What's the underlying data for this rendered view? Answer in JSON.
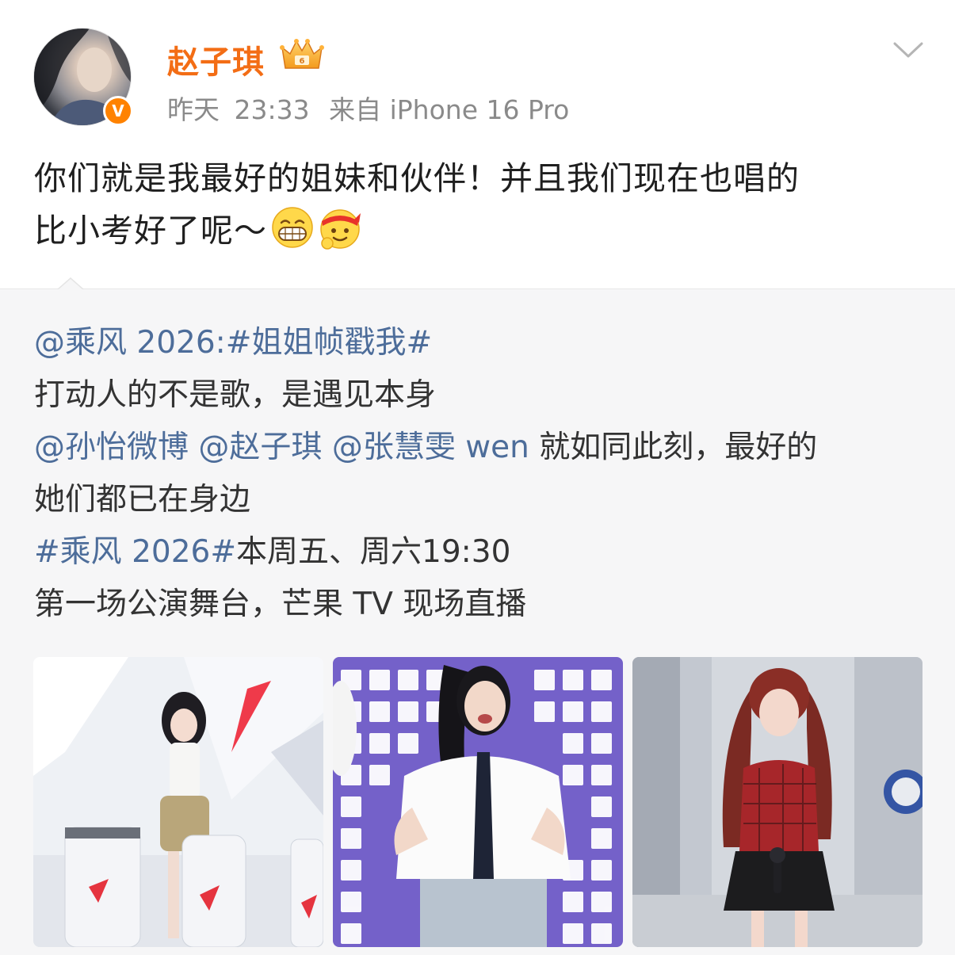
{
  "post": {
    "username": "赵子琪",
    "time_day": "昨天",
    "time_clock": "23:33",
    "source": "来自 iPhone 16 Pro",
    "verified_mark": "V",
    "text_line1": "你们就是我最好的姐妹和伙伴！并且我们现在也唱的",
    "text_line2": "比小考好了呢～"
  },
  "repost": {
    "author_mention": "@乘风 2026",
    "colon": ":",
    "hashtag1": "#姐姐帧戳我#",
    "line2": "打动人的不是歌，是遇见本身",
    "mentions": [
      "@孙怡微博",
      "@赵子琪",
      "@张慧雯 wen"
    ],
    "line3_tail": " 就如同此刻，最好的",
    "line4": "她们都已在身边",
    "hashtag2": "#乘风 2026#",
    "line5_tail": "本周五、周六19:30",
    "line6": "第一场公演舞台，芒果 TV 现场直播"
  },
  "icons": {
    "crown": "crown-badge-icon",
    "chevron": "chevron-down-icon",
    "emoji1": "grin-emoji-icon",
    "emoji2": "headband-emoji-icon"
  },
  "colors": {
    "username": "#f36d15",
    "link": "#4d6d9a",
    "verified": "#ff8200",
    "repost_bg": "#f6f6f7"
  }
}
